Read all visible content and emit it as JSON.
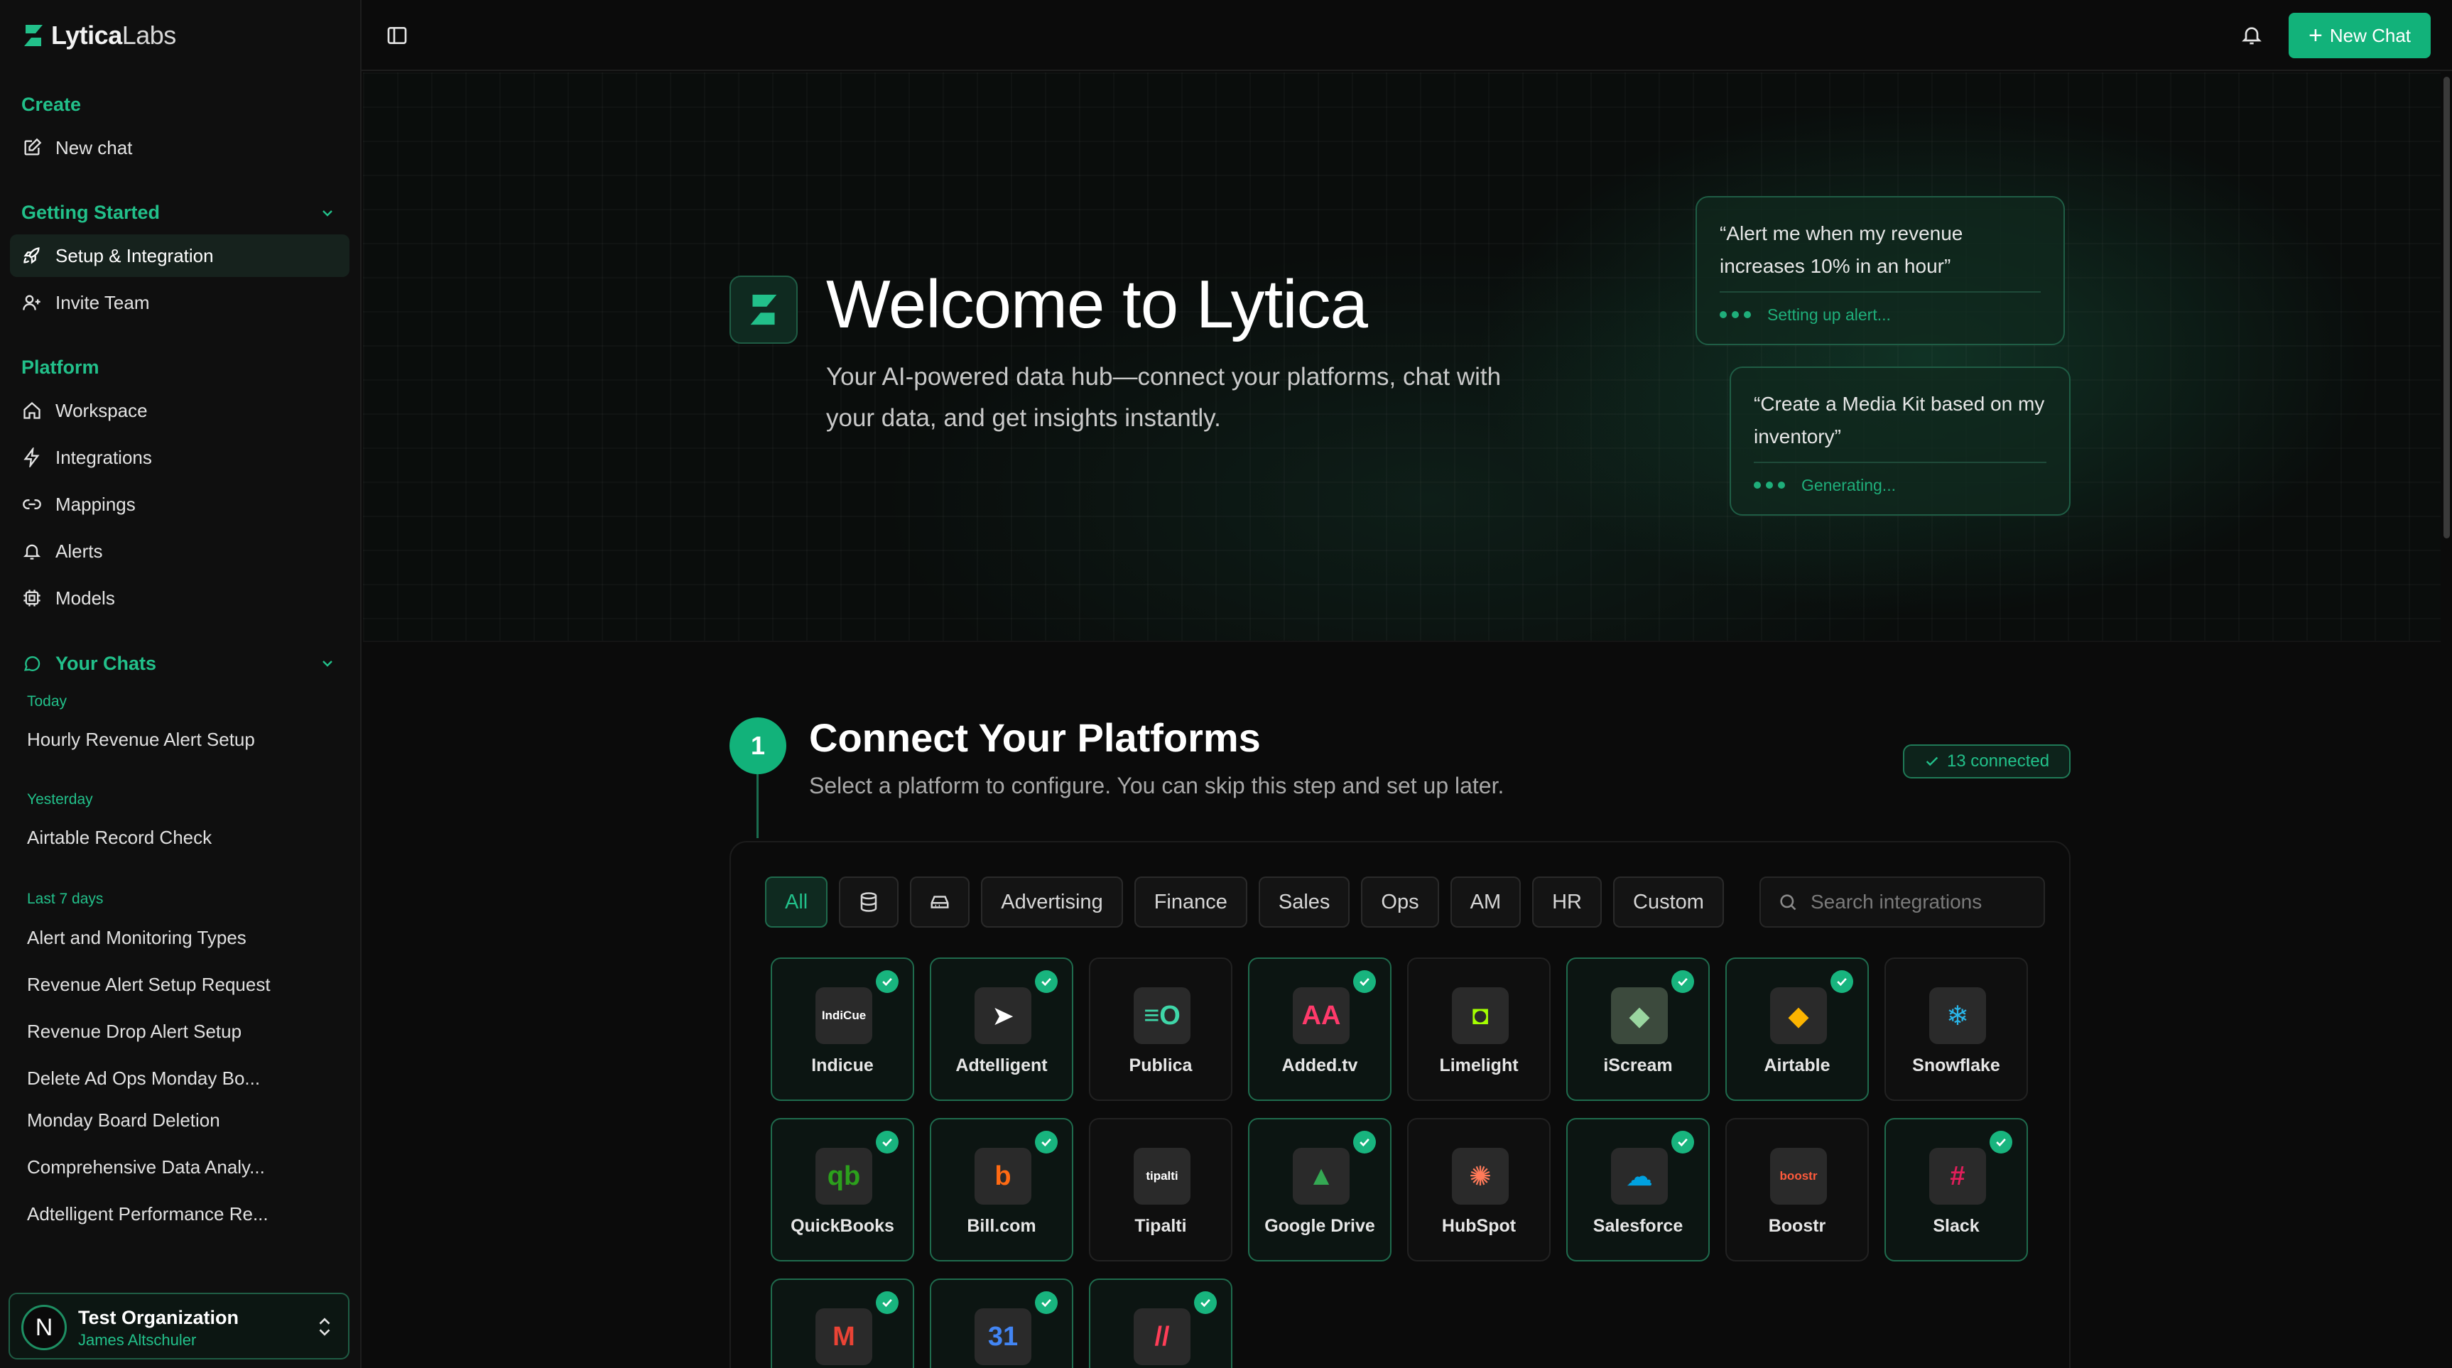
{
  "app": {
    "brand_bold": "Lytica",
    "brand_light": "Labs"
  },
  "sidebar": {
    "create_heading": "Create",
    "new_chat": "New chat",
    "getting_started_heading": "Getting Started",
    "getting_started_items": [
      {
        "label": "Setup & Integration",
        "icon": "rocket-icon",
        "active": true
      },
      {
        "label": "Invite Team",
        "icon": "user-plus-icon",
        "active": false
      }
    ],
    "platform_heading": "Platform",
    "platform_items": [
      {
        "label": "Workspace",
        "icon": "home-icon"
      },
      {
        "label": "Integrations",
        "icon": "bolt-icon"
      },
      {
        "label": "Mappings",
        "icon": "link-icon"
      },
      {
        "label": "Alerts",
        "icon": "bell-icon"
      },
      {
        "label": "Models",
        "icon": "chip-icon"
      }
    ],
    "chats_heading": "Your Chats",
    "chat_groups": [
      {
        "label": "Today",
        "chats": [
          "Hourly Revenue Alert Setup"
        ]
      },
      {
        "label": "Yesterday",
        "chats": [
          "Airtable Record Check"
        ]
      },
      {
        "label": "Last 7 days",
        "chats": [
          "Alert and Monitoring Types",
          "Revenue Alert Setup Request",
          "Revenue Drop Alert Setup",
          "Delete Ad Ops Monday Bo...",
          "Monday Board Deletion",
          "Comprehensive Data Analy...",
          "Adtelligent Performance Re..."
        ]
      }
    ],
    "org": {
      "avatar_letter": "N",
      "name": "Test Organization",
      "user": "James Altschuler"
    }
  },
  "header": {
    "new_chat_label": "New Chat"
  },
  "hero": {
    "title": "Welcome to Lytica",
    "subtitle": "Your AI-powered data hub—connect your platforms, chat with your data, and get insights instantly.",
    "bubbles": [
      {
        "quote": "“Alert me when my revenue increases 10% in an hour”",
        "status": "Setting up alert..."
      },
      {
        "quote": "“Create a Media Kit based on my inventory”",
        "status": "Generating..."
      }
    ]
  },
  "step": {
    "number": "1",
    "title": "Connect Your Platforms",
    "subtitle": "Select a platform to configure. You can skip this step and set up later.",
    "connected_badge": "13 connected"
  },
  "filters": {
    "all": "All",
    "icon_filters": [
      "database-icon",
      "storage-drive-icon"
    ],
    "categories": [
      "Advertising",
      "Finance",
      "Sales",
      "Ops",
      "AM",
      "HR",
      "Custom"
    ],
    "search_placeholder": "Search integrations"
  },
  "integrations": [
    {
      "name": "Indicue",
      "connected": true,
      "logo_bg": "#2a2a2a",
      "logo_text": "IndiCue",
      "logo_color": "#ffffff"
    },
    {
      "name": "Adtelligent",
      "connected": true,
      "logo_bg": "#2a2a2a",
      "logo_text": "➤",
      "logo_color": "#ffffff"
    },
    {
      "name": "Publica",
      "connected": false,
      "logo_bg": "#2a2a2a",
      "logo_text": "≡O",
      "logo_color": "#3fd6a8"
    },
    {
      "name": "Added.tv",
      "connected": true,
      "logo_bg": "#2a2a2a",
      "logo_text": "AA",
      "logo_color": "#ff3a6b"
    },
    {
      "name": "Limelight",
      "connected": false,
      "logo_bg": "#2a2a2a",
      "logo_text": "◘",
      "logo_color": "#a4ff00"
    },
    {
      "name": "iScream",
      "connected": true,
      "logo_bg": "#3c4a3d",
      "logo_text": "◆",
      "logo_color": "#9ad6a0"
    },
    {
      "name": "Airtable",
      "connected": true,
      "logo_bg": "#2a2a2a",
      "logo_text": "◆",
      "logo_color": "#fcb400"
    },
    {
      "name": "Snowflake",
      "connected": false,
      "logo_bg": "#2a2a2a",
      "logo_text": "❄",
      "logo_color": "#29b5e8"
    },
    {
      "name": "QuickBooks",
      "connected": true,
      "logo_bg": "#2a2a2a",
      "logo_text": "qb",
      "logo_color": "#2ca01c"
    },
    {
      "name": "Bill.com",
      "connected": true,
      "logo_bg": "#2a2a2a",
      "logo_text": "b",
      "logo_color": "#ff6a13"
    },
    {
      "name": "Tipalti",
      "connected": false,
      "logo_bg": "#2a2a2a",
      "logo_text": "tipalti",
      "logo_color": "#ffffff"
    },
    {
      "name": "Google Drive",
      "connected": true,
      "logo_bg": "#2a2a2a",
      "logo_text": "▲",
      "logo_color": "#34a853"
    },
    {
      "name": "HubSpot",
      "connected": false,
      "logo_bg": "#2a2a2a",
      "logo_text": "✺",
      "logo_color": "#ff7a59"
    },
    {
      "name": "Salesforce",
      "connected": true,
      "logo_bg": "#2a2a2a",
      "logo_text": "☁",
      "logo_color": "#00a1e0"
    },
    {
      "name": "Boostr",
      "connected": false,
      "logo_bg": "#2a2a2a",
      "logo_text": "boostr",
      "logo_color": "#ff5a3c"
    },
    {
      "name": "Slack",
      "connected": true,
      "logo_bg": "#2a2a2a",
      "logo_text": "#",
      "logo_color": "#e01e5a"
    },
    {
      "name": "",
      "connected": true,
      "logo_bg": "#2a2a2a",
      "logo_text": "M",
      "logo_color": "#ea4335"
    },
    {
      "name": "",
      "connected": true,
      "logo_bg": "#2a2a2a",
      "logo_text": "31",
      "logo_color": "#4285f4"
    },
    {
      "name": "",
      "connected": true,
      "logo_bg": "#2a2a2a",
      "logo_text": "//",
      "logo_color": "#ff3d57"
    }
  ],
  "colors": {
    "accent": "#12b27a",
    "accent_text": "#22c08a"
  }
}
